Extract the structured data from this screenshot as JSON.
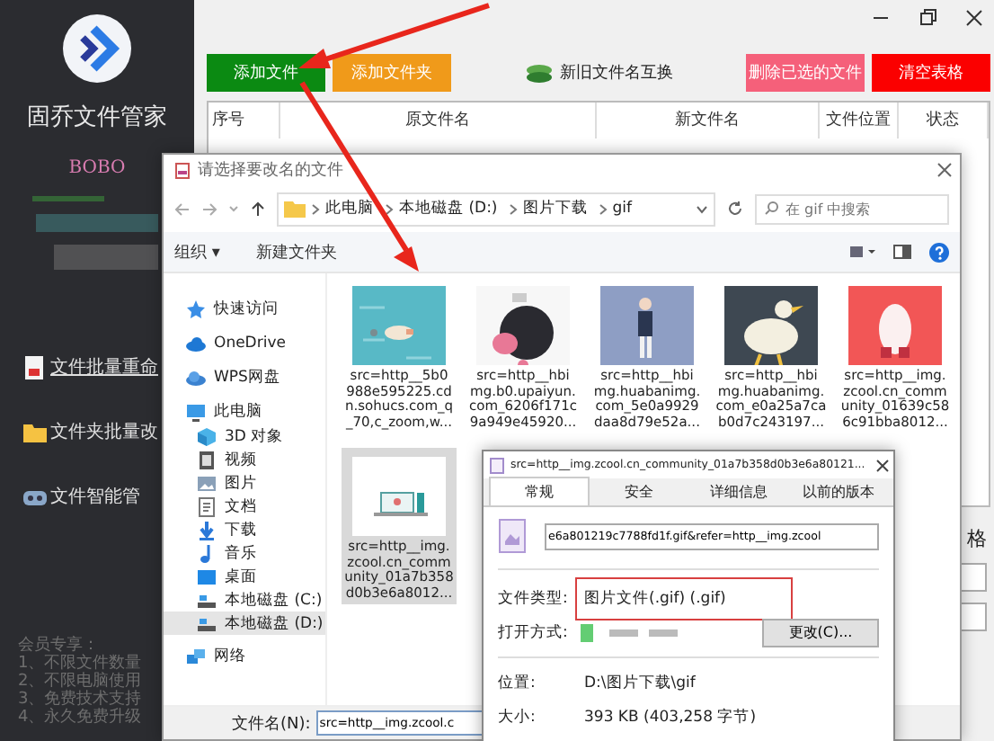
{
  "sidebar": {
    "app_name": "固乔文件管家",
    "user": "BOBO",
    "menu": [
      {
        "label": "文件批量重命",
        "underlined": true
      },
      {
        "label": "文件夹批量改",
        "underlined": false
      },
      {
        "label": "文件智能管",
        "underlined": false
      }
    ],
    "footer": [
      "会员专享：",
      "1、不限文件数量",
      "2、不限电脑使用",
      "3、免费技术支持",
      "4、永久免费升级"
    ]
  },
  "main": {
    "buttons": [
      {
        "label": "添加文件",
        "color": "#0b8a12",
        "kind": "solid"
      },
      {
        "label": "添加文件夹",
        "color": "#f09a1a",
        "kind": "solid"
      },
      {
        "label": "新旧文件名互换",
        "color": "#f0f0f0",
        "kind": "swap"
      },
      {
        "label": "删除已选的文件",
        "color": "#f5607a",
        "kind": "solid"
      },
      {
        "label": "清空表格",
        "color": "#fb0000",
        "kind": "solid"
      }
    ],
    "table": {
      "columns": [
        "序号",
        "原文件名",
        "新文件名",
        "文件位置",
        "状态"
      ]
    },
    "side_label": "格"
  },
  "file_dialog": {
    "title": "请选择要改名的文件",
    "breadcrumb": [
      "此电脑",
      "本地磁盘 (D:)",
      "图片下载",
      "gif"
    ],
    "search": {
      "placeholder": "在 gif 中搜索"
    },
    "toolbar": [
      "组织 ▾",
      "新建文件夹"
    ],
    "nav": [
      {
        "label": "快速访问",
        "selected": false
      },
      {
        "label": "OneDrive",
        "selected": false
      },
      {
        "label": "WPS网盘",
        "selected": false
      },
      {
        "label": "此电脑",
        "selected": false,
        "children": [
          {
            "label": "3D 对象",
            "selected": false
          },
          {
            "label": "视频",
            "selected": false
          },
          {
            "label": "图片",
            "selected": false
          },
          {
            "label": "文档",
            "selected": false
          },
          {
            "label": "下载",
            "selected": false
          },
          {
            "label": "音乐",
            "selected": false
          },
          {
            "label": "桌面",
            "selected": false
          },
          {
            "label": "本地磁盘 (C:)",
            "selected": false
          },
          {
            "label": "本地磁盘 (D:)",
            "selected": true
          }
        ]
      },
      {
        "label": "网络",
        "selected": false
      }
    ],
    "files": [
      {
        "lines": [
          "src=http__5b0",
          "988e595225.cd",
          "n.sohucs.com_q",
          "_70,c_zoom,w..."
        ],
        "selected": false,
        "kind": "picture"
      },
      {
        "lines": [
          "src=http__hbi",
          "mg.b0.upaiyun.",
          "com_6206f171c",
          "9a949e45920..."
        ],
        "selected": false,
        "kind": "picture"
      },
      {
        "lines": [
          "src=http__hbi",
          "mg.huabanimg.",
          "com_5e0a9929",
          "daa8d79e52a..."
        ],
        "selected": false,
        "kind": "picture"
      },
      {
        "lines": [
          "src=http__hbi",
          "mg.huabanimg.",
          "com_e0a25a7ca",
          "b0d7c243197..."
        ],
        "selected": false,
        "kind": "picture"
      },
      {
        "lines": [
          "src=http__img.",
          "zcool.cn_comm",
          "unity_01639c58",
          "6c91bba8012..."
        ],
        "selected": false,
        "kind": "picture"
      },
      {
        "lines": [
          "src=http__img.",
          "zcool.cn_comm",
          "unity_01a7b358",
          "d0b3e6a8012..."
        ],
        "selected": true,
        "kind": "picture"
      }
    ],
    "filename": {
      "label": "文件名(N):",
      "value": "src=http__img.zcool.c"
    }
  },
  "properties": {
    "title": "src=http__img.zcool.cn_community_01a7b358d0b3e6a80121...",
    "tabs": [
      {
        "label": "常规",
        "selected": true
      },
      {
        "label": "安全",
        "selected": false
      },
      {
        "label": "详细信息",
        "selected": false
      },
      {
        "label": "以前的版本",
        "selected": false
      }
    ],
    "name_value": "e6a801219c7788fd1f.gif&refer=http__img.zcool",
    "rows": [
      {
        "kind": "text",
        "label": "文件类型:",
        "value": "图片文件(.gif) (.gif)",
        "highlighted": true
      },
      {
        "kind": "app",
        "label": "打开方式:",
        "button": "更改(C)...",
        "highlighted": false
      },
      {
        "kind": "divider"
      },
      {
        "kind": "text",
        "label": "位置:",
        "value": "D:\\图片下载\\gif",
        "highlighted": false
      },
      {
        "kind": "text",
        "label": "大小:",
        "value": "393 KB (403,258 字节)",
        "highlighted": false
      }
    ]
  }
}
